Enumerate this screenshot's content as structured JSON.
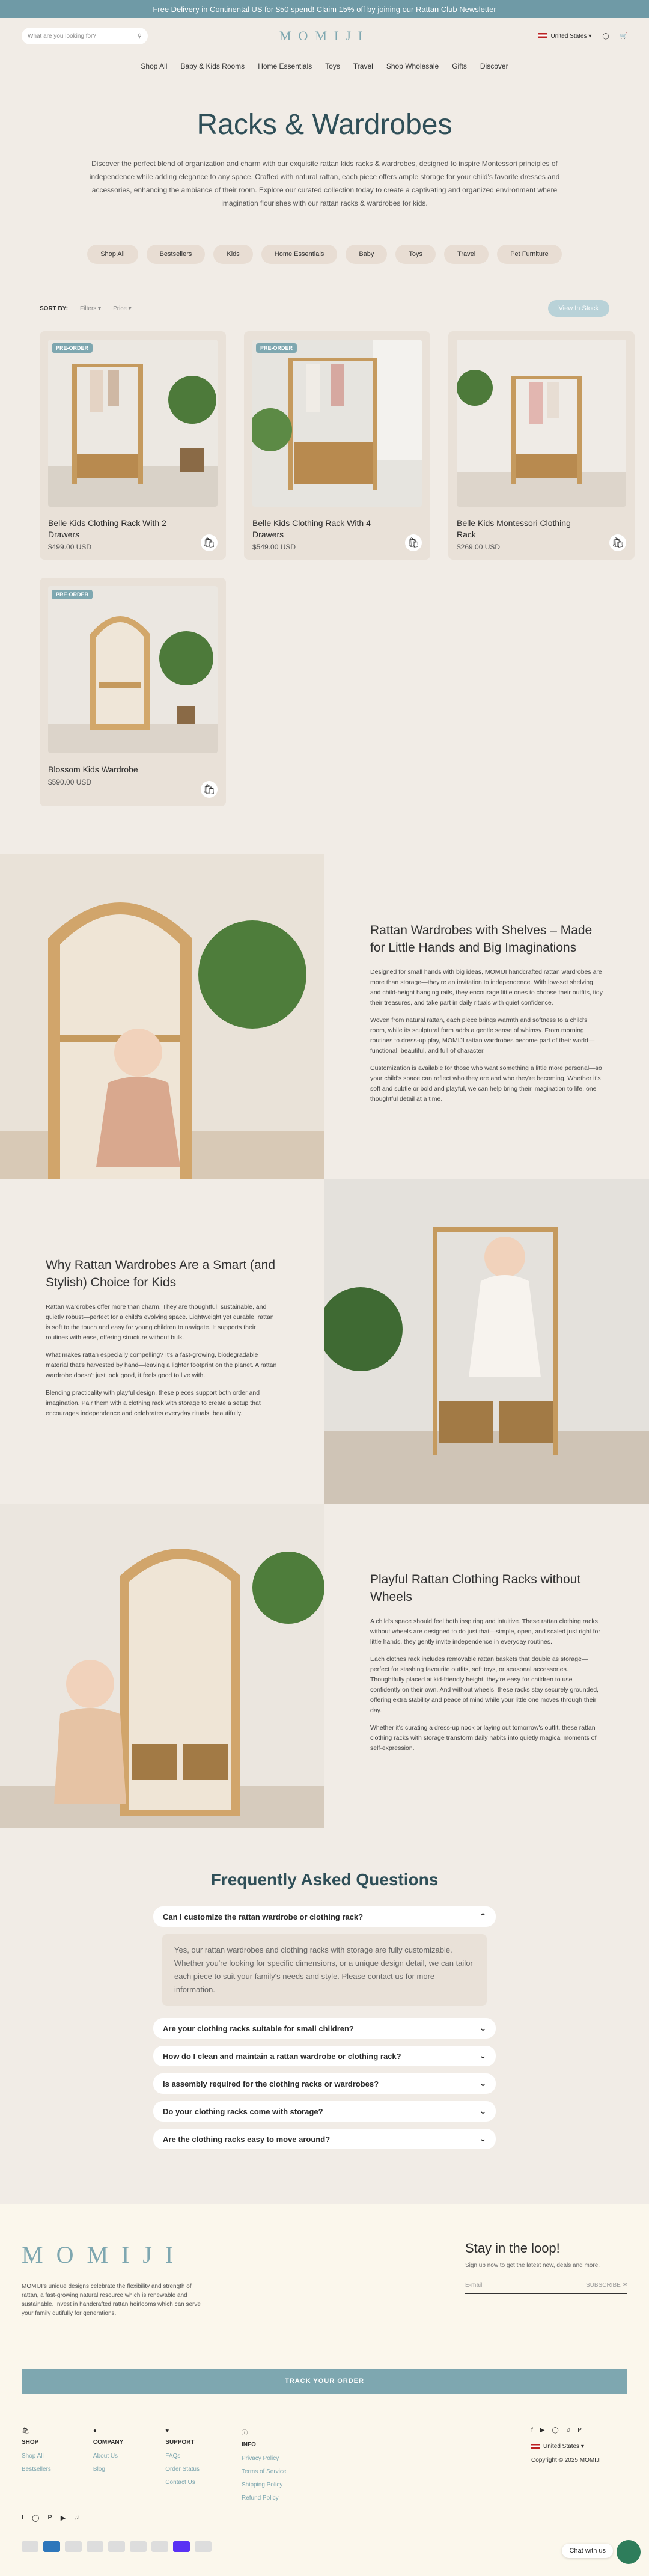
{
  "announcement": "Free Delivery in Continental US for $50 spend! Claim 15% off by joining our Rattan Club Newsletter",
  "header": {
    "search_placeholder": "What are you looking for?",
    "logo": "MOMIJI",
    "country": "United States"
  },
  "nav": [
    "Shop All",
    "Baby & Kids Rooms",
    "Home Essentials",
    "Toys",
    "Travel",
    "Shop Wholesale",
    "Gifts",
    "Discover"
  ],
  "hero": {
    "title": "Racks & Wardrobes",
    "description": "Discover the perfect blend of organization and charm with our exquisite rattan kids racks & wardrobes, designed to inspire Montessori principles of independence while adding elegance to any space. Crafted with natural rattan, each piece offers ample storage for your child's favorite dresses and accessories, enhancing the ambiance of their room. Explore our curated collection today to create a captivating and organized environment where imagination flourishes with our rattan racks & wardrobes for kids."
  },
  "chips": [
    "Shop All",
    "Bestsellers",
    "Kids",
    "Home Essentials",
    "Baby",
    "Toys",
    "Travel",
    "Pet Furniture"
  ],
  "toolbar": {
    "sort_label": "SORT BY:",
    "filters": "Filters",
    "price": "Price",
    "in_stock": "View In Stock"
  },
  "products": [
    {
      "name": "Belle Kids Clothing Rack With 2 Drawers",
      "price": "$499.00 USD",
      "badge": "PRE-ORDER"
    },
    {
      "name": "Belle Kids Clothing Rack With 4 Drawers",
      "price": "$549.00 USD",
      "badge": "PRE-ORDER"
    },
    {
      "name": "Belle Kids Montessori Clothing Rack",
      "price": "$269.00 USD",
      "badge": ""
    },
    {
      "name": "Blossom Kids Wardrobe",
      "price": "$590.00 USD",
      "badge": "PRE-ORDER"
    }
  ],
  "features": [
    {
      "title": "Rattan Wardrobes with Shelves – Made for Little Hands and Big Imaginations",
      "p1": "Designed for small hands with big ideas, MOMIJI handcrafted rattan wardrobes are more than storage—they're an invitation to independence. With low-set shelving and child-height hanging rails, they encourage little ones to choose their outfits, tidy their treasures, and take part in daily rituals with quiet confidence.",
      "p2": "Woven from natural rattan, each piece brings warmth and softness to a child's room, while its sculptural form adds a gentle sense of whimsy. From morning routines to dress-up play, MOMIJI rattan wardrobes become part of their world—functional, beautiful, and full of character.",
      "p3": "Customization is available for those who want something a little more personal—so your child's space can reflect who they are and who they're becoming. Whether it's soft and subtle or bold and playful, we can help bring their imagination to life, one thoughtful detail at a time."
    },
    {
      "title": "Why Rattan Wardrobes Are a Smart (and Stylish) Choice for Kids",
      "p1": "Rattan wardrobes offer more than charm. They are thoughtful, sustainable, and quietly robust—perfect for a child's evolving space. Lightweight yet durable, rattan is soft to the touch and easy for young children to navigate. It supports their routines with ease, offering structure without bulk.",
      "p2": "What makes rattan especially compelling? It's a fast-growing, biodegradable material that's harvested by hand—leaving a lighter footprint on the planet. A rattan wardrobe doesn't just look good, it feels good to live with.",
      "p3": "Blending practicality with playful design, these pieces support both order and imagination. Pair them with a clothing rack with storage to create a setup that encourages independence and celebrates everyday rituals, beautifully."
    },
    {
      "title": "Playful Rattan Clothing Racks without Wheels",
      "p1": "A child's space should feel both inspiring and intuitive. These rattan clothing racks without wheels are designed to do just that—simple, open, and scaled just right for little hands, they gently invite independence in everyday routines.",
      "p2": "Each clothes rack includes removable rattan baskets that double as storage—perfect for stashing favourite outfits, soft toys, or seasonal accessories. Thoughtfully placed at kid-friendly height, they're easy for children to use confidently on their own. And without wheels, these racks stay securely grounded, offering extra stability and peace of mind while your little one moves through their day.",
      "p3": "Whether it's curating a dress-up nook or laying out tomorrow's outfit, these rattan clothing racks with storage transform daily habits into quietly magical moments of self-expression."
    }
  ],
  "faq": {
    "title": "Frequently Asked Questions",
    "open_question": "Can I customize the rattan wardrobe or clothing rack?",
    "open_answer": "Yes, our rattan wardrobes and clothing racks with storage are fully customizable. Whether you're looking for specific dimensions, or a unique design detail, we can tailor each piece to suit your family's needs and style. Please contact us for more information.",
    "questions": [
      "Are your clothing racks suitable for small children?",
      "How do I clean and maintain a rattan wardrobe or clothing rack?",
      "Is assembly required for the clothing racks or wardrobes?",
      "Do your clothing racks come with storage?",
      "Are the clothing racks easy to move around?"
    ]
  },
  "footer": {
    "logo": "MOMIJI",
    "description": "MOMIJI's unique designs celebrate the flexibility and strength of rattan, a fast-growing natural resource which is renewable and sustainable. Invest in handcrafted rattan heirlooms which can serve your family dutifully for generations.",
    "newsletter_title": "Stay in the loop!",
    "newsletter_sub": "Sign up now to get the latest new, deals and more.",
    "email_placeholder": "E-mail",
    "subscribe": "SUBSCRIBE",
    "track": "TRACK YOUR ORDER",
    "shop_title": "SHOP",
    "shop_links": [
      "Shop All",
      "Bestsellers"
    ],
    "company_title": "COMPANY",
    "company_links": [
      "About Us",
      "Blog"
    ],
    "support_title": "SUPPORT",
    "support_links": [
      "FAQs",
      "Order Status",
      "Contact Us"
    ],
    "info_title": "INFO",
    "info_links": [
      "Privacy Policy",
      "Terms of Service",
      "Shipping Policy",
      "Refund Policy"
    ],
    "country": "United States",
    "copyright": "Copyright © 2025 MOMIJI",
    "chat": "Chat with us"
  }
}
